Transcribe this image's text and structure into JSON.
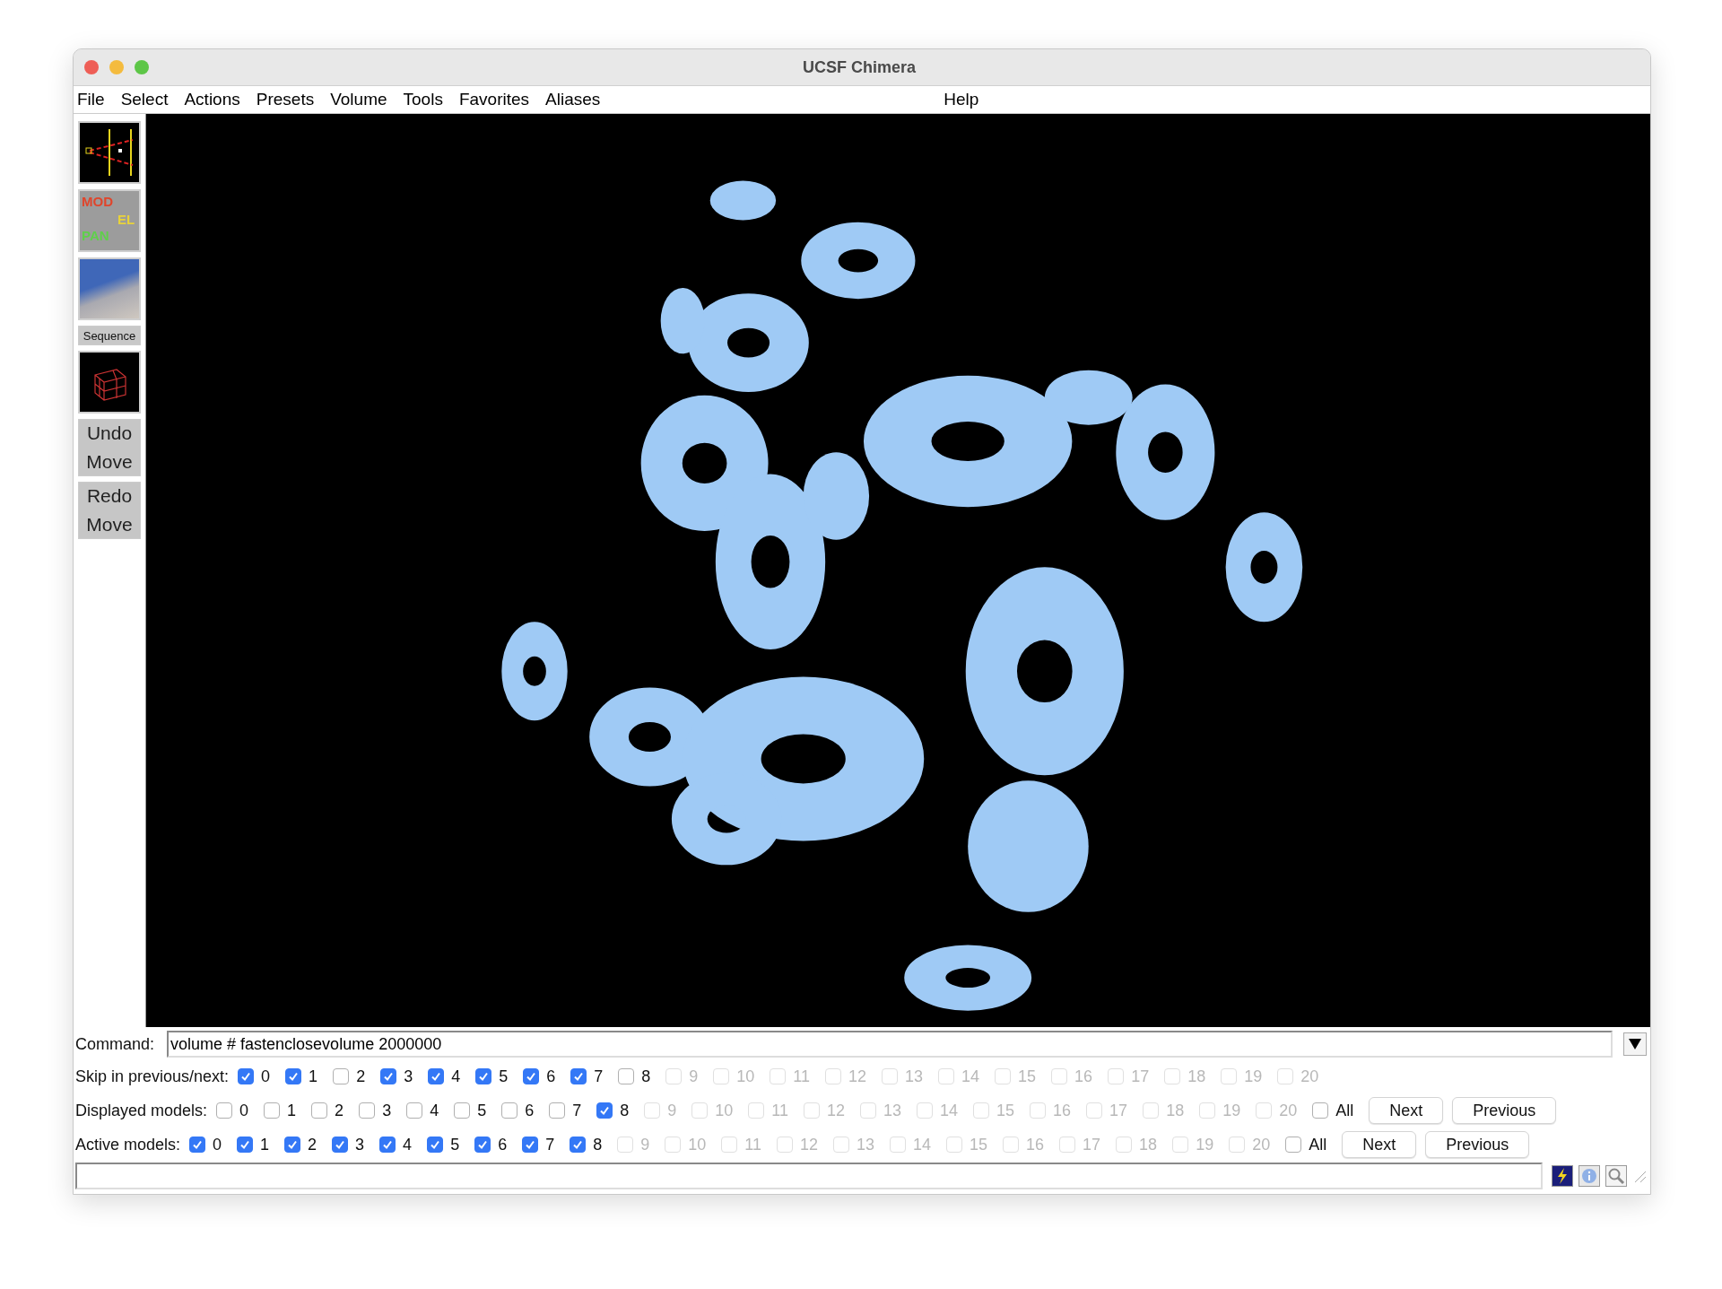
{
  "window": {
    "title": "UCSF Chimera"
  },
  "menu": {
    "items": [
      "File",
      "Select",
      "Actions",
      "Presets",
      "Volume",
      "Tools",
      "Favorites",
      "Aliases"
    ],
    "help": "Help"
  },
  "toolbar": [
    {
      "kind": "camera"
    },
    {
      "kind": "model_panel",
      "words": [
        "MOD",
        "EL",
        "PAN"
      ]
    },
    {
      "kind": "photo"
    },
    {
      "kind": "label",
      "text": "Sequence"
    },
    {
      "kind": "cube"
    },
    {
      "kind": "button",
      "lines": [
        "Undo",
        "Move"
      ]
    },
    {
      "kind": "button",
      "lines": [
        "Redo",
        "Move"
      ]
    }
  ],
  "command": {
    "label": "Command:",
    "value": "volume # fastenclosevolume 2000000"
  },
  "model_rows": [
    {
      "label": "Skip in previous/next:",
      "items": [
        {
          "label": "0",
          "checked": true,
          "disabled": false
        },
        {
          "label": "1",
          "checked": true,
          "disabled": false
        },
        {
          "label": "2",
          "checked": false,
          "disabled": false
        },
        {
          "label": "3",
          "checked": true,
          "disabled": false
        },
        {
          "label": "4",
          "checked": true,
          "disabled": false
        },
        {
          "label": "5",
          "checked": true,
          "disabled": false
        },
        {
          "label": "6",
          "checked": true,
          "disabled": false
        },
        {
          "label": "7",
          "checked": true,
          "disabled": false
        },
        {
          "label": "8",
          "checked": false,
          "disabled": false
        },
        {
          "label": "9",
          "checked": false,
          "disabled": true
        },
        {
          "label": "10",
          "checked": false,
          "disabled": true
        },
        {
          "label": "11",
          "checked": false,
          "disabled": true
        },
        {
          "label": "12",
          "checked": false,
          "disabled": true
        },
        {
          "label": "13",
          "checked": false,
          "disabled": true
        },
        {
          "label": "14",
          "checked": false,
          "disabled": true
        },
        {
          "label": "15",
          "checked": false,
          "disabled": true
        },
        {
          "label": "16",
          "checked": false,
          "disabled": true
        },
        {
          "label": "17",
          "checked": false,
          "disabled": true
        },
        {
          "label": "18",
          "checked": false,
          "disabled": true
        },
        {
          "label": "19",
          "checked": false,
          "disabled": true
        },
        {
          "label": "20",
          "checked": false,
          "disabled": true
        }
      ]
    },
    {
      "label": "Displayed models:",
      "items": [
        {
          "label": "0",
          "checked": false,
          "disabled": false
        },
        {
          "label": "1",
          "checked": false,
          "disabled": false
        },
        {
          "label": "2",
          "checked": false,
          "disabled": false
        },
        {
          "label": "3",
          "checked": false,
          "disabled": false
        },
        {
          "label": "4",
          "checked": false,
          "disabled": false
        },
        {
          "label": "5",
          "checked": false,
          "disabled": false
        },
        {
          "label": "6",
          "checked": false,
          "disabled": false
        },
        {
          "label": "7",
          "checked": false,
          "disabled": false
        },
        {
          "label": "8",
          "checked": true,
          "disabled": false
        },
        {
          "label": "9",
          "checked": false,
          "disabled": true
        },
        {
          "label": "10",
          "checked": false,
          "disabled": true
        },
        {
          "label": "11",
          "checked": false,
          "disabled": true
        },
        {
          "label": "12",
          "checked": false,
          "disabled": true
        },
        {
          "label": "13",
          "checked": false,
          "disabled": true
        },
        {
          "label": "14",
          "checked": false,
          "disabled": true
        },
        {
          "label": "15",
          "checked": false,
          "disabled": true
        },
        {
          "label": "16",
          "checked": false,
          "disabled": true
        },
        {
          "label": "17",
          "checked": false,
          "disabled": true
        },
        {
          "label": "18",
          "checked": false,
          "disabled": true
        },
        {
          "label": "19",
          "checked": false,
          "disabled": true
        },
        {
          "label": "20",
          "checked": false,
          "disabled": true
        }
      ],
      "all": {
        "label": "All",
        "checked": false
      },
      "buttons": [
        "Next",
        "Previous"
      ]
    },
    {
      "label": "Active models:",
      "items": [
        {
          "label": "0",
          "checked": true,
          "disabled": false
        },
        {
          "label": "1",
          "checked": true,
          "disabled": false
        },
        {
          "label": "2",
          "checked": true,
          "disabled": false
        },
        {
          "label": "3",
          "checked": true,
          "disabled": false
        },
        {
          "label": "4",
          "checked": true,
          "disabled": false
        },
        {
          "label": "5",
          "checked": true,
          "disabled": false
        },
        {
          "label": "6",
          "checked": true,
          "disabled": false
        },
        {
          "label": "7",
          "checked": true,
          "disabled": false
        },
        {
          "label": "8",
          "checked": true,
          "disabled": false
        },
        {
          "label": "9",
          "checked": false,
          "disabled": true
        },
        {
          "label": "10",
          "checked": false,
          "disabled": true
        },
        {
          "label": "11",
          "checked": false,
          "disabled": true
        },
        {
          "label": "12",
          "checked": false,
          "disabled": true
        },
        {
          "label": "13",
          "checked": false,
          "disabled": true
        },
        {
          "label": "14",
          "checked": false,
          "disabled": true
        },
        {
          "label": "15",
          "checked": false,
          "disabled": true
        },
        {
          "label": "16",
          "checked": false,
          "disabled": true
        },
        {
          "label": "17",
          "checked": false,
          "disabled": true
        },
        {
          "label": "18",
          "checked": false,
          "disabled": true
        },
        {
          "label": "19",
          "checked": false,
          "disabled": true
        },
        {
          "label": "20",
          "checked": false,
          "disabled": true
        }
      ],
      "all": {
        "label": "All",
        "checked": false
      },
      "buttons": [
        "Next",
        "Previous"
      ]
    }
  ]
}
